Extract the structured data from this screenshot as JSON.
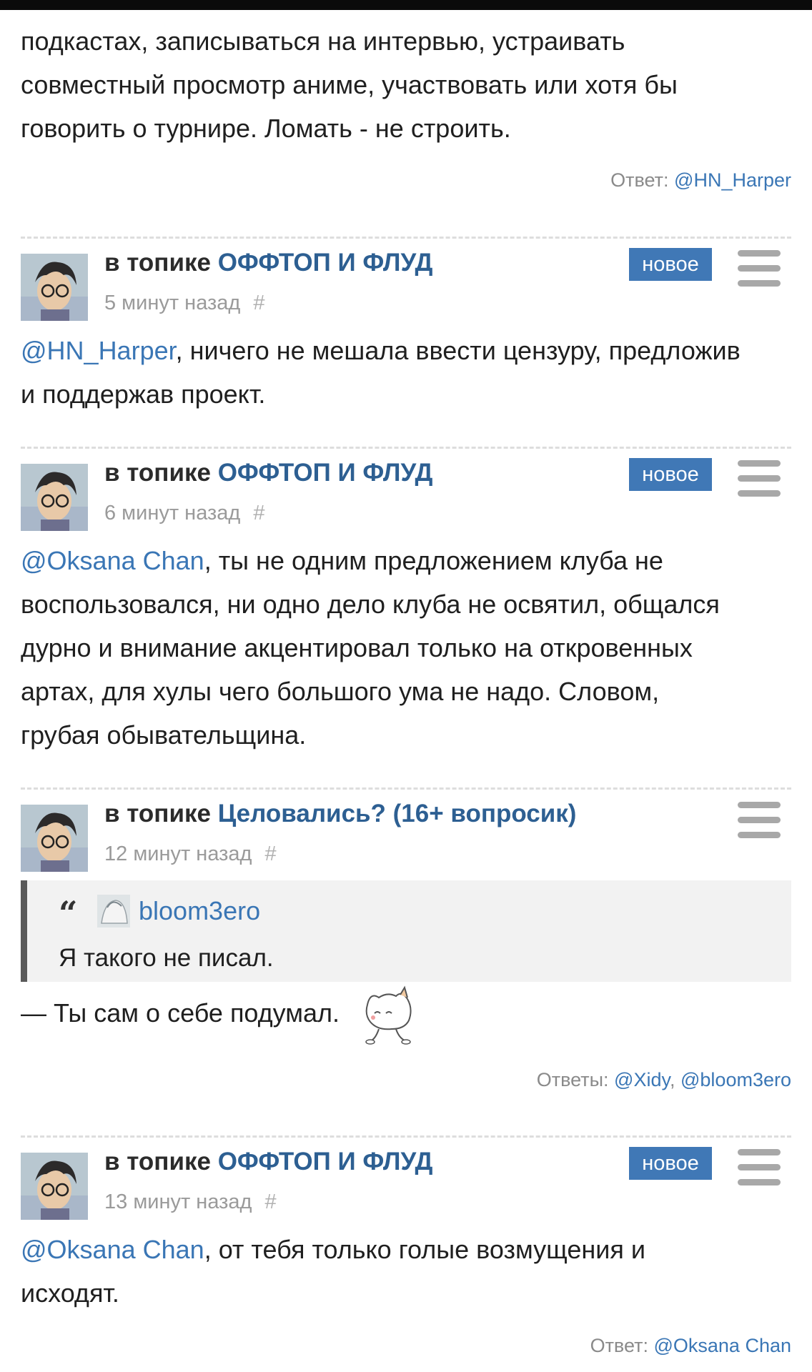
{
  "first_comment": {
    "lines": [
      "подкастах, записываться на интервью, устраивать",
      "совместный просмотр аниме, участвовать или хотя бы",
      "говорить о турнире. Ломать - не строить."
    ],
    "reply_label": "Ответ:",
    "reply_user": "@HN_Harper"
  },
  "comments": [
    {
      "prefix": "в топике",
      "topic": "ОФФТОП И ФЛУД",
      "time": "5 минут назад",
      "hash": "#",
      "badge": "новое",
      "mention": "@HN_Harper",
      "text": ", ничего не мешала ввести цензуру, предложив",
      "text_line2": "и поддержав проект."
    },
    {
      "prefix": "в топике",
      "topic": "ОФФТОП И ФЛУД",
      "time": "6 минут назад",
      "hash": "#",
      "badge": "новое",
      "mention": "@Oksana Chan",
      "text": ", ты не одним предложением клуба не",
      "more_lines": [
        "воспользовался, ни одно дело клуба не освятил, общался",
        "дурно и внимание акцентировал только на откровенных",
        "артах, для хулы чего большого ума не надо. Словом,",
        "грубая обывательщина."
      ]
    },
    {
      "prefix": "в топике",
      "topic": "Целовались? (16+ вопросик)",
      "time": "12 минут назад",
      "hash": "#",
      "quote_user": "bloom3ero",
      "quote_text": "Я такого не писал.",
      "text": "— Ты сам о себе подумал.",
      "replies_label": "Ответы:",
      "replies": [
        "@Xidy",
        "@bloom3ero"
      ]
    },
    {
      "prefix": "в топике",
      "topic": "ОФФТОП И ФЛУД",
      "time": "13 минут назад",
      "hash": "#",
      "badge": "новое",
      "mention": "@Oksana Chan",
      "text": ", от тебя только голые возмущения и",
      "text_line2": "исходят.",
      "reply_label": "Ответ:",
      "reply_user": "@Oksana Chan"
    }
  ],
  "icons": {
    "menu": "hamburger-menu-icon",
    "quote": "quote-icon",
    "sticker": "cat-sticker-icon"
  },
  "colors": {
    "accent_link": "#3a76b5",
    "topic_link": "#2d5f92",
    "badge_bg": "#4078b6"
  }
}
